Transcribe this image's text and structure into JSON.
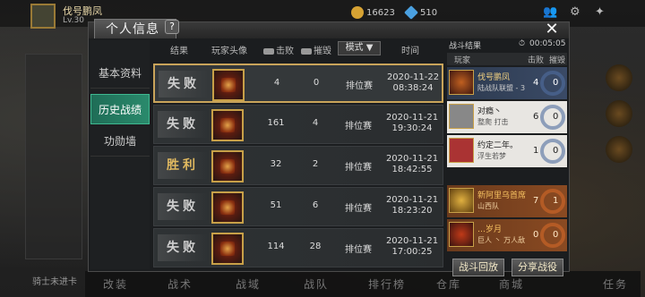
{
  "profile": {
    "name": "伐号鹏凤",
    "level_text": "Lv.30",
    "coins": "16623",
    "diamonds": "510"
  },
  "window": {
    "title": "个人信息",
    "help": "?",
    "close": "✕"
  },
  "side_menu": [
    {
      "label": "基本资料"
    },
    {
      "label": "历史战绩"
    },
    {
      "label": "功勋墙"
    }
  ],
  "table": {
    "headers": {
      "result": "结果",
      "avatar": "玩家头像",
      "kills": "击败",
      "destroy": "摧毁",
      "mode": "模式 ▼",
      "time": "时间"
    },
    "rows": [
      {
        "result": "失败",
        "kills": "4",
        "destroy": "0",
        "mode": "排位赛",
        "date": "2020-11-22",
        "time": "08:38:24"
      },
      {
        "result": "失败",
        "kills": "161",
        "destroy": "4",
        "mode": "排位赛",
        "date": "2020-11-21",
        "time": "19:30:24"
      },
      {
        "result": "胜利",
        "kills": "32",
        "destroy": "2",
        "mode": "排位赛",
        "date": "2020-11-21",
        "time": "18:42:55"
      },
      {
        "result": "失败",
        "kills": "51",
        "destroy": "6",
        "mode": "排位赛",
        "date": "2020-11-21",
        "time": "18:23:20"
      },
      {
        "result": "失败",
        "kills": "114",
        "destroy": "28",
        "mode": "排位赛",
        "date": "2020-11-21",
        "time": "17:00:25"
      }
    ]
  },
  "battle_result": {
    "title": "战斗结果",
    "duration": "00:05:05",
    "col_player": "玩家",
    "col_kills": "击败",
    "col_destroy": "摧毁",
    "players": [
      {
        "name": "伐号鹏凤",
        "tag": "陆战队联盟 - 3",
        "kills": "4",
        "destroy": "0",
        "style": "blue"
      },
      {
        "name": "对瘾丶",
        "tag": "整爬 打击",
        "kills": "6",
        "destroy": "0",
        "style": "white"
      },
      {
        "name": "约定二年。",
        "tag": "浮生若梦",
        "kills": "1",
        "destroy": "0",
        "style": "white"
      },
      {
        "name": "新阿里乌首席",
        "tag": "山西队",
        "kills": "7",
        "destroy": "1",
        "style": "orange"
      },
      {
        "name": "…岁月",
        "tag": "巨人 丶 万人敌",
        "kills": "0",
        "destroy": "0",
        "style": "orange"
      }
    ],
    "replay_button": "战斗回放",
    "share_button": "分享战役"
  },
  "bottom_nav": [
    "改装",
    "战术",
    "战域",
    "战队",
    "排行榜",
    "仓库",
    "商城",
    "任务"
  ],
  "bottom_message": "骑士未进卡"
}
